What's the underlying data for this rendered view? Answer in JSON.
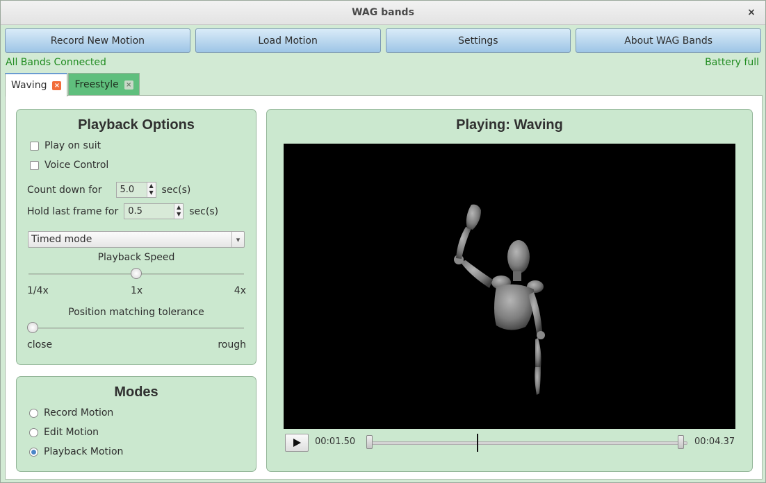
{
  "window": {
    "title": "WAG bands",
    "close_glyph": "×"
  },
  "toolbar": [
    "Record New Motion",
    "Load Motion",
    "Settings",
    "About WAG Bands"
  ],
  "status": {
    "connection": "All Bands Connected",
    "battery": "Battery full",
    "color": "#1f8b1f"
  },
  "tabs": [
    {
      "label": "Waving",
      "active": true
    },
    {
      "label": "Freestyle",
      "active": false
    }
  ],
  "playback_options": {
    "title": "Playback Options",
    "play_on_suit": {
      "label": "Play on suit",
      "checked": false
    },
    "voice_control": {
      "label": "Voice Control",
      "checked": false
    },
    "countdown": {
      "label": "Count down for",
      "value": "5.0",
      "unit": "sec(s)"
    },
    "hold_last": {
      "label": "Hold last frame for",
      "value": "0.5",
      "unit": "sec(s)"
    },
    "mode_select": {
      "selected": "Timed mode"
    },
    "speed": {
      "label": "Playback Speed",
      "min_label": "1/4x",
      "mid_label": "1x",
      "max_label": "4x",
      "value_fraction": 0.5
    },
    "tolerance": {
      "label": "Position matching tolerance",
      "min_label": "close",
      "max_label": "rough",
      "value_fraction": 0.0
    }
  },
  "modes": {
    "title": "Modes",
    "options": [
      {
        "label": "Record Motion",
        "checked": false
      },
      {
        "label": "Edit Motion",
        "checked": false
      },
      {
        "label": "Playback Motion",
        "checked": true
      }
    ]
  },
  "viewer": {
    "title": "Playing: Waving",
    "current_time": "00:01.50",
    "end_time": "00:04.37",
    "icons": {
      "play": "play-icon"
    }
  }
}
